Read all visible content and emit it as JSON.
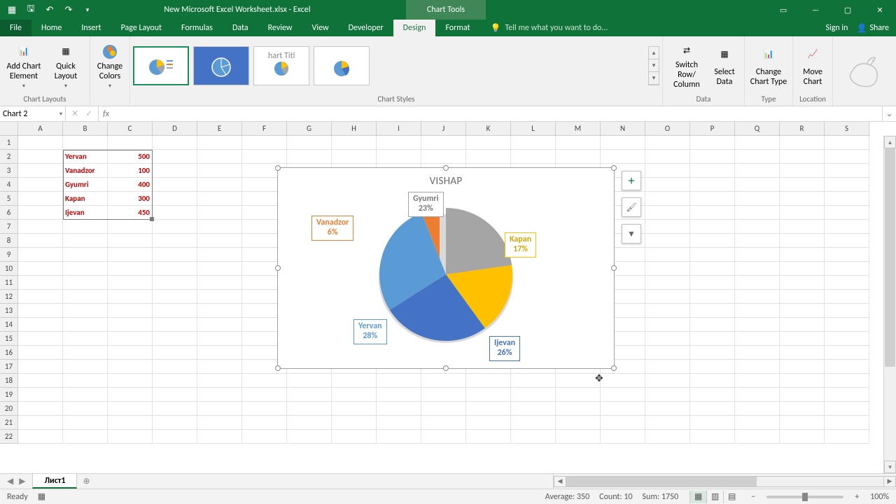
{
  "titlebar": {
    "doc_title": "New Microsoft Excel Worksheet.xlsx - Excel",
    "chart_tools": "Chart Tools"
  },
  "tabs": {
    "file": "File",
    "home": "Home",
    "insert": "Insert",
    "page_layout": "Page Layout",
    "formulas": "Formulas",
    "data": "Data",
    "review": "Review",
    "view": "View",
    "developer": "Developer",
    "design": "Design",
    "format": "Format",
    "tellme": "Tell me what you want to do...",
    "signin": "Sign in",
    "share": "Share"
  },
  "ribbon": {
    "add_chart_element": "Add Chart Element",
    "quick_layout": "Quick Layout",
    "change_colors": "Change Colors",
    "switch_row_col": "Switch Row/ Column",
    "select_data": "Select Data",
    "change_chart_type": "Change Chart Type",
    "move_chart": "Move Chart",
    "grp_chart_layouts": "Chart Layouts",
    "grp_chart_styles": "Chart Styles",
    "grp_data": "Data",
    "grp_type": "Type",
    "grp_location": "Location"
  },
  "name_box": "Chart 2",
  "columns": [
    "A",
    "B",
    "C",
    "D",
    "E",
    "F",
    "G",
    "H",
    "I",
    "J",
    "K",
    "L",
    "M",
    "N",
    "O",
    "P",
    "Q",
    "R",
    "S"
  ],
  "rows": 22,
  "table": {
    "rows": [
      {
        "label": "Yervan",
        "value": "500"
      },
      {
        "label": "Vanadzor",
        "value": "100"
      },
      {
        "label": "Gyumri",
        "value": "400"
      },
      {
        "label": "Kapan",
        "value": "300"
      },
      {
        "label": "Ijevan",
        "value": "450"
      }
    ]
  },
  "chart": {
    "title": "VISHAP",
    "labels": {
      "gyumri": {
        "name": "Gyumri",
        "pct": "23%",
        "color": "#a5a5a5"
      },
      "vanadzor": {
        "name": "Vanadzor",
        "pct": "6%",
        "color": "#ed7d31"
      },
      "kapan": {
        "name": "Kapan",
        "pct": "17%",
        "color": "#ffc000"
      },
      "ijevan": {
        "name": "Ijevan",
        "pct": "26%",
        "color": "#4472c4"
      },
      "yervan": {
        "name": "Yervan",
        "pct": "28%",
        "color": "#5b9bd5"
      }
    }
  },
  "chart_data": {
    "type": "pie",
    "title": "VISHAP",
    "categories": [
      "Yervan",
      "Vanadzor",
      "Gyumri",
      "Kapan",
      "Ijevan"
    ],
    "values": [
      500,
      100,
      400,
      300,
      450
    ],
    "percentages": [
      28,
      6,
      23,
      17,
      26
    ],
    "colors": {
      "Yervan": "#5b9bd5",
      "Vanadzor": "#ed7d31",
      "Gyumri": "#a5a5a5",
      "Kapan": "#ffc000",
      "Ijevan": "#4472c4"
    },
    "exploded_slice": "Vanadzor",
    "data_labels": "callout_name_percent"
  },
  "sheet_tab": "Лист1",
  "status": {
    "ready": "Ready",
    "average_lbl": "Average:",
    "average_val": "350",
    "count_lbl": "Count:",
    "count_val": "10",
    "sum_lbl": "Sum:",
    "sum_val": "1750",
    "zoom": "100%"
  }
}
